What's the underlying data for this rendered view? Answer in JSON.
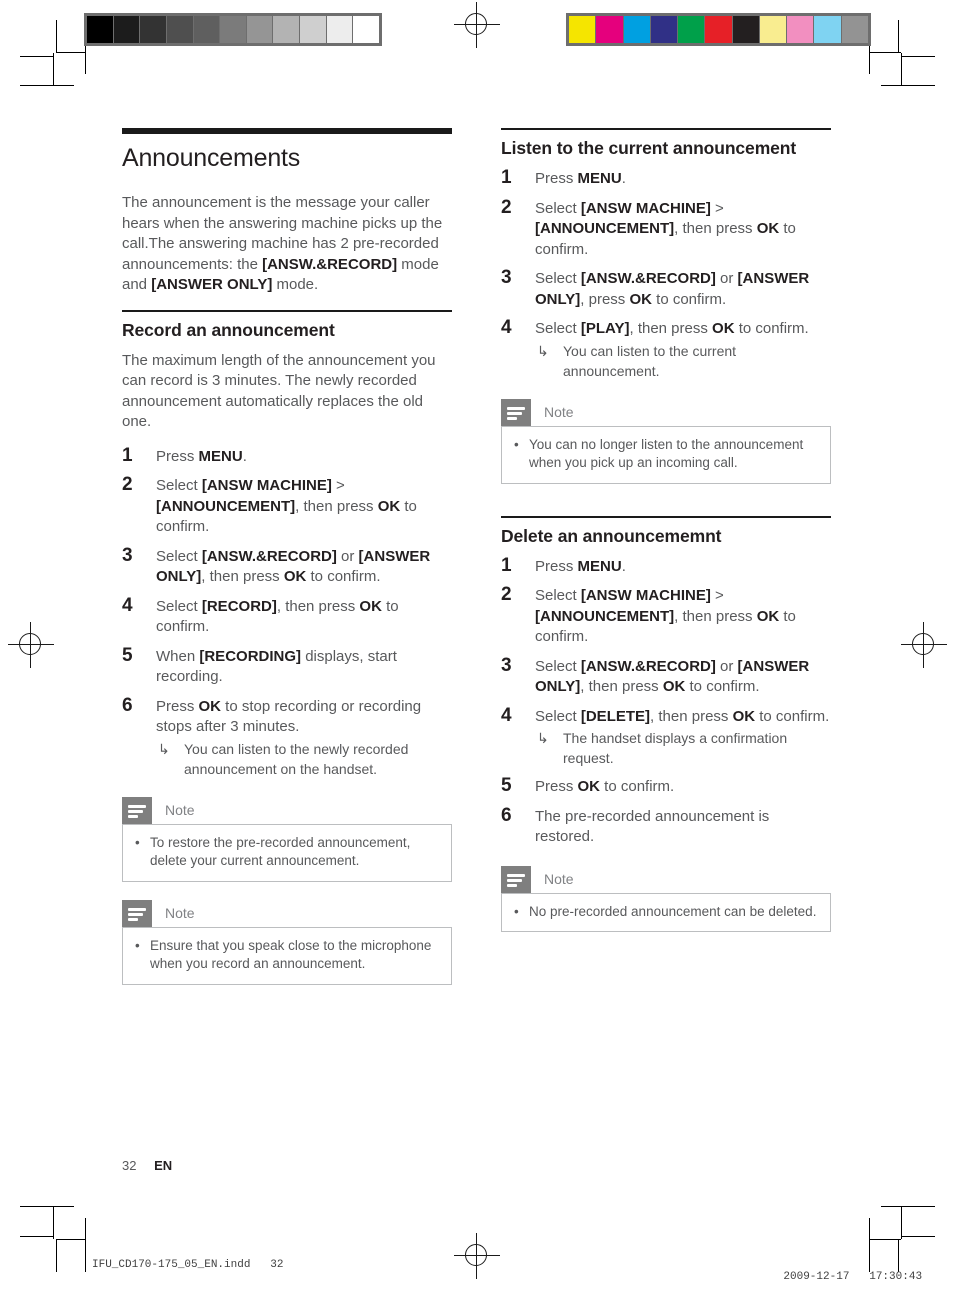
{
  "document": {
    "title": "Announcements",
    "intro": "The announcement is the message your caller hears when the answering machine picks up the call.The answering machine has 2 pre-recorded announcements: the <b>[ANSW.&amp;RECORD]</b> mode and <b>[ANSWER ONLY]</b> mode."
  },
  "left_column": {
    "record_section": {
      "heading": "Record an announcement",
      "intro": "The maximum length of the announcement you can record is 3 minutes. The newly recorded announcement automatically replaces the old one.",
      "steps": [
        {
          "num": "1",
          "text": "Press <b>MENU</b>."
        },
        {
          "num": "2",
          "text": "Select <b>[ANSW MACHINE]</b> &gt; <b>[ANNOUNCEMENT]</b>, then press <b>OK</b> to confirm."
        },
        {
          "num": "3",
          "text": "Select <b>[ANSW.&amp;RECORD]</b> or <b>[ANSWER ONLY]</b>, then press <b>OK</b> to confirm."
        },
        {
          "num": "4",
          "text": "Select <b>[RECORD]</b>, then press <b>OK</b> to confirm."
        },
        {
          "num": "5",
          "text": "When <b>[RECORDING]</b> displays, start recording."
        },
        {
          "num": "6",
          "text": "Press <b>OK</b> to stop recording or recording stops after 3 minutes.",
          "substeps": [
            "You can listen to the newly recorded announcement on the handset."
          ]
        }
      ]
    },
    "notes": [
      {
        "label": "Note",
        "icon": "note-icon",
        "items": [
          "To restore the pre-recorded announcement, delete your current announcement."
        ]
      },
      {
        "label": "Note",
        "icon": "note-icon",
        "items": [
          "Ensure that you speak close to the microphone when you record an announcement."
        ]
      }
    ]
  },
  "right_column": {
    "listen_section": {
      "heading": "Listen to the current announcement",
      "steps": [
        {
          "num": "1",
          "text": "Press <b>MENU</b>."
        },
        {
          "num": "2",
          "text": "Select <b>[ANSW MACHINE]</b> &gt; <b>[ANNOUNCEMENT]</b>, then press <b>OK</b> to confirm."
        },
        {
          "num": "3",
          "text": "Select <b>[ANSW.&amp;RECORD]</b> or <b>[ANSWER ONLY]</b>, press <b>OK</b> to confirm."
        },
        {
          "num": "4",
          "text": "Select <b>[PLAY]</b>, then press <b>OK</b> to confirm.",
          "substeps": [
            "You can listen to the current announcement."
          ]
        }
      ]
    },
    "listen_note": {
      "label": "Note",
      "icon": "note-icon",
      "items": [
        "You can no longer listen to the announcement when you pick up an incoming call."
      ]
    },
    "delete_section": {
      "heading": "Delete an announcememnt",
      "steps": [
        {
          "num": "1",
          "text": "Press <b>MENU</b>."
        },
        {
          "num": "2",
          "text": "Select <b>[ANSW MACHINE]</b> &gt; <b>[ANNOUNCEMENT]</b>, then press <b>OK</b> to confirm."
        },
        {
          "num": "3",
          "text": "Select <b>[ANSW.&amp;RECORD]</b> or <b>[ANSWER ONLY]</b>, then press <b>OK</b> to confirm."
        },
        {
          "num": "4",
          "text": "Select <b>[DELETE]</b>, then press <b>OK</b> to confirm.",
          "substeps": [
            "The handset displays a confirmation request."
          ]
        },
        {
          "num": "5",
          "text": "Press <b>OK</b> to confirm."
        },
        {
          "num": "6",
          "text": "The pre-recorded announcement is restored."
        }
      ]
    },
    "delete_note": {
      "label": "Note",
      "icon": "note-icon",
      "items": [
        "No pre-recorded announcement can be deleted."
      ]
    }
  },
  "footer": {
    "page_number": "32",
    "language": "EN",
    "slug_file": "IFU_CD170-175_05_EN.indd   32",
    "slug_date": "2009-12-17",
    "slug_time": "17:30:43"
  },
  "print_marks": {
    "grayscale_bar": [
      "#000000",
      "#1c1c1c",
      "#333333",
      "#4f4f4f",
      "#5f5f5f",
      "#7b7b7b",
      "#959595",
      "#b3b3b3",
      "#cfcfcf",
      "#ededed",
      "#ffffff"
    ],
    "color_bar": [
      "#f5e500",
      "#e5007d",
      "#00a0e1",
      "#303086",
      "#00a04a",
      "#e62027",
      "#231f20",
      "#f9ed90",
      "#f28fc0",
      "#7fd3f2",
      "#939393"
    ]
  }
}
